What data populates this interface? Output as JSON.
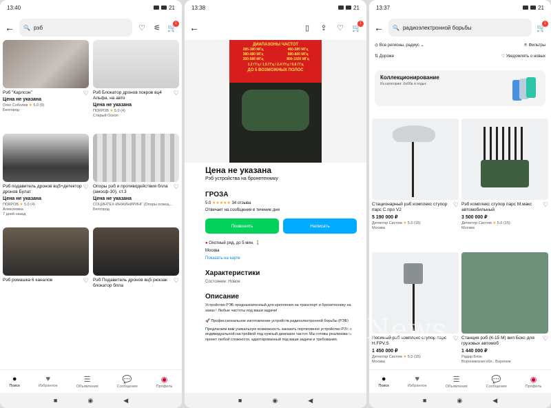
{
  "watermark": "CNews",
  "screen1": {
    "status_time": "13:40",
    "battery": "21",
    "search_value": "рэб",
    "items": [
      {
        "title": "Рэб \"Карлсон\"",
        "price": "Цена не указана",
        "seller": "Олег Соболев",
        "rating": "5.0",
        "reviews": "(9)",
        "location": "Белгород",
        "date": ""
      },
      {
        "title": "Рэб Блокатор дронов покров вц4 Альфа, на авто",
        "price": "Цена не указана",
        "seller": "ПОКРОВ",
        "rating": "5.0",
        "reviews": "(4)",
        "location": "Старый Оскол",
        "date": ""
      },
      {
        "title": "Рэб подавитель дронов вц5+детектор дронов Булат",
        "price": "Цена не указана",
        "seller": "ПОКРОВ",
        "rating": "5.0",
        "reviews": "(4)",
        "location": "Алексеевка",
        "date": "7 дней назад"
      },
      {
        "title": "Опоры рэб и противодействия бпла (амосф-30), ст.3",
        "price": "Цена не указана",
        "seller": "СОЦИНТЕХ-ИНЖИНИРИНГ (Опоры освещ...",
        "rating": "",
        "reviews": "",
        "location": "Белгород",
        "date": ""
      },
      {
        "title": "Рэб ромашка 6 каналов",
        "price": "",
        "seller": "",
        "rating": "",
        "reviews": "",
        "location": "",
        "date": ""
      },
      {
        "title": "Рэб Подавитель дронов вц5 рюкзак блокатор бпла",
        "price": "",
        "seller": "",
        "rating": "",
        "reviews": "",
        "location": "",
        "date": ""
      }
    ],
    "nav": [
      "Поиск",
      "Избранное",
      "Объявления",
      "Сообщения",
      "Профиль"
    ]
  },
  "screen2": {
    "status_time": "13:38",
    "battery": "21",
    "banner_title": "ДИАПАЗОНЫ ЧАСТОТ",
    "bands": [
      "285-380 МГц",
      "460-580 МГц",
      "380-480 МГц",
      "580-800 МГц",
      "350-580 МГц",
      "800-1020 МГц",
      "1.2 ГГц / 1.5 ГГц / 2.4 ГГц / 5.8 ГГц",
      "ДО 5 ВОЗМОЖНЫХ ПОЛОС"
    ],
    "price": "Цена не указана",
    "subtitle": "Рэб устройства на бронетехнику",
    "seller": "ГРОЗА",
    "rating": "5.0",
    "reviews": "34 отзыва",
    "response": "Отвечает на сообщения в течение дня",
    "call": "Позвонить",
    "write": "Написать",
    "metro": "Охотный ряд",
    "walk": "до 5 мин.",
    "city": "Москва",
    "map_link": "Показать на карте",
    "char_title": "Характеристики",
    "condition": "Состояние: Новое",
    "desc_title": "Описание",
    "desc1": "Устройство РЭБ предназначенный для крепления на транспорт и бронетехнику на заказ ! Любые частоты под ваши задачи!",
    "desc2": "🚀 Профессиональное изготовление устройств радиоэлектронной борьбы (РЭБ)",
    "desc3": "Предлагаем вам уникальную возможность заказать портативное устройство РЭБ с индивидуальной настройкой под нужный диапазон частот. Мы готовы реализовать проект любой сложности, адаптированный под ваши задачи и требования."
  },
  "screen3": {
    "status_time": "13:37",
    "battery": "21",
    "search_value": "радиоэлектронной борьбы",
    "region": "Все регионы, радиус",
    "filters": "Фильтры",
    "sort": "Дороже",
    "notify": "Уведомлять о новых",
    "coll_title": "Коллекционирование",
    "coll_sub": "Из категории: Хобби и отдых",
    "items": [
      {
        "title": "Стационарный рэб комплекс ступор парс С.про V2",
        "price": "5 190 000 ₽",
        "seller": "Детектор Систем",
        "rating": "5.0",
        "reviews": "(15)",
        "location": "Москва"
      },
      {
        "title": "Рэб комплекс ступор парс М.макс автомобильный",
        "price": "3 500 000 ₽",
        "seller": "Детектор Систем",
        "rating": "5.0",
        "reviews": "(15)",
        "location": "Москва"
      },
      {
        "title": "Носимый рэб комплекс ступор парс Н.FPV.S",
        "price": "1 450 000 ₽",
        "seller": "Детектор Систем",
        "rating": "5.0",
        "reviews": "(15)",
        "location": "Москва"
      },
      {
        "title": "Станция рэб (К-15 М) вип Бокс для грузовых автомоб",
        "price": "1 440 000 ₽",
        "seller": "Радир Блок",
        "rating": "",
        "reviews": "",
        "location": "Воронежская обл., Воронеж"
      }
    ],
    "nav": [
      "Поиск",
      "Избранное",
      "Объявления",
      "Сообщения",
      "Профиль"
    ]
  },
  "colors": {
    "green": "#02d15c",
    "blue": "#00aaff",
    "badge": "#ff3b30",
    "star": "#f5a623"
  }
}
